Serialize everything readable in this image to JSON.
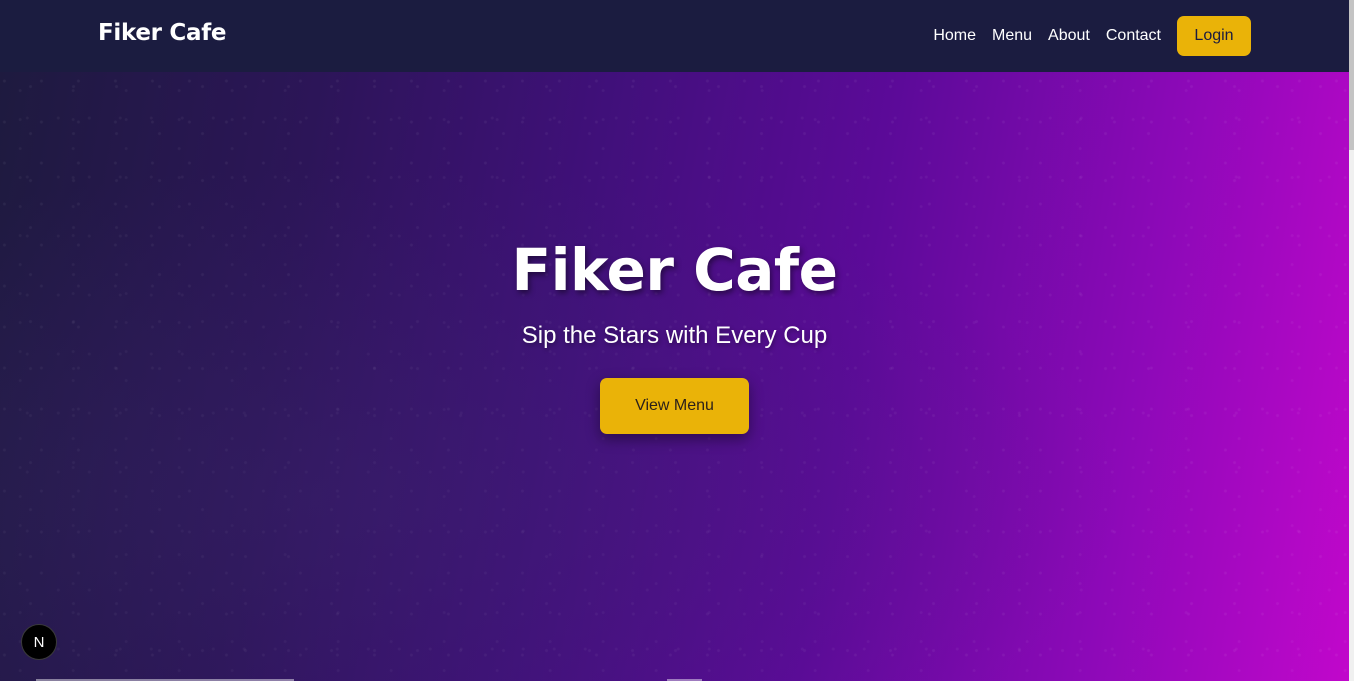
{
  "header": {
    "brand": "Fiker Cafe",
    "nav": [
      {
        "label": "Home"
      },
      {
        "label": "Menu"
      },
      {
        "label": "About"
      },
      {
        "label": "Contact"
      }
    ],
    "login_label": "Login"
  },
  "hero": {
    "title": "Fiker Cafe",
    "subtitle": "Sip the Stars with Every Cup",
    "cta_label": "View Menu"
  },
  "devtools_badge": {
    "letter": "N"
  },
  "colors": {
    "navbar_bg": "#1b1c40",
    "accent": "#eab308",
    "gradient_start": "#1e1a3f",
    "gradient_end": "#c107cb"
  }
}
